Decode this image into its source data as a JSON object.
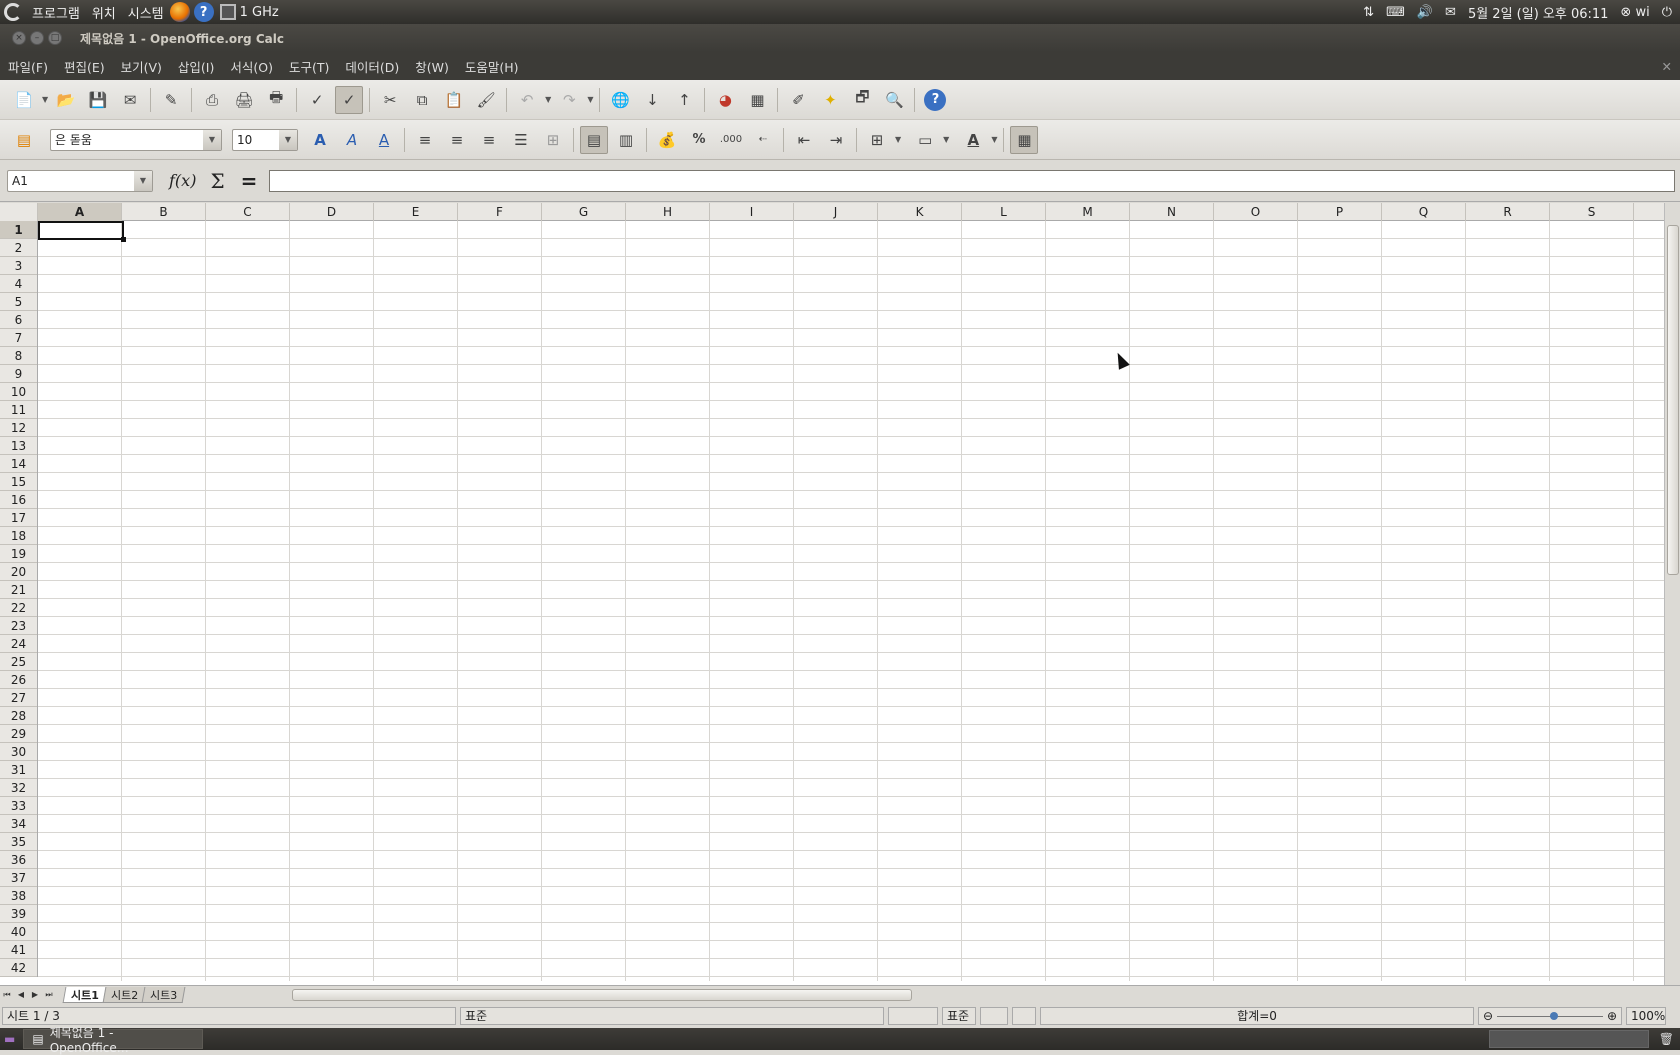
{
  "topbar": {
    "menus": [
      "프로그램",
      "위치",
      "시스템"
    ],
    "cpu": "1 GHz",
    "clock": "5월 2일 (일) 오후 06:11",
    "user": "wi"
  },
  "window": {
    "title": "제목없음 1 - OpenOffice.org Calc"
  },
  "menubar": [
    "파일(F)",
    "편집(E)",
    "보기(V)",
    "삽입(I)",
    "서식(O)",
    "도구(T)",
    "데이터(D)",
    "창(W)",
    "도움말(H)"
  ],
  "format": {
    "font_name": "은 돋움",
    "font_size": "10",
    "percent_label": "%",
    "thousands_label": ".000"
  },
  "formula": {
    "name_box": "A1",
    "fx": "f(x)",
    "sigma": "Σ",
    "equals": "=",
    "content": ""
  },
  "columns": [
    "A",
    "B",
    "C",
    "D",
    "E",
    "F",
    "G",
    "H",
    "I",
    "J",
    "K",
    "L",
    "M",
    "N",
    "O",
    "P",
    "Q",
    "R",
    "S"
  ],
  "rows": [
    "1",
    "2",
    "3",
    "4",
    "5",
    "6",
    "7",
    "8",
    "9",
    "10",
    "11",
    "12",
    "13",
    "14",
    "15",
    "16",
    "17",
    "18",
    "19",
    "20",
    "21",
    "22",
    "23",
    "24",
    "25",
    "26",
    "27",
    "28",
    "29",
    "30",
    "31",
    "32",
    "33",
    "34",
    "35",
    "36",
    "37",
    "38",
    "39",
    "40",
    "41",
    "42"
  ],
  "selected_cell": "A1",
  "sheets": [
    "시트1",
    "시트2",
    "시트3"
  ],
  "status": {
    "sheet": "시트 1 / 3",
    "style": "표준",
    "mode": "표준",
    "sum": "합계=0",
    "zoom": "100%"
  },
  "taskbar": {
    "item": "제목없음 1 - OpenOffice…"
  }
}
